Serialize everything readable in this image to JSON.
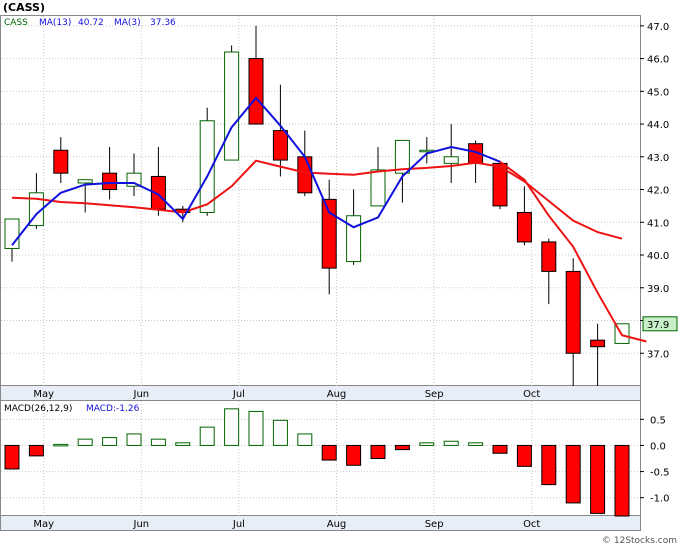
{
  "header": {
    "title": "(CASS)",
    "legend": {
      "ticker": "CASS",
      "ma13_label": "MA(13)",
      "ma13_value": "40.72",
      "ma3_label": "MA(3)",
      "ma3_value": "37.36"
    },
    "macd_legend": {
      "label": "MACD(26,12,9)",
      "value_label": "MACD:-1.26"
    }
  },
  "footer": {
    "copyright": "© 12Stocks.com"
  },
  "colors": {
    "down_candle": "#ff0000",
    "up_candle": "#ffffff",
    "up_outline": "#006400",
    "ma13": "#ee1111",
    "ma3": "#1111dd",
    "macd_neg": "#ff0000",
    "macd_pos": "#ffffff",
    "last_price_box": "#c8f0c8",
    "grid": "#c8c8c8",
    "text_dark": "#000000",
    "text_blue": "#1111dd",
    "text_green": "#006400"
  },
  "chart_data": [
    {
      "type": "candlestick",
      "title": "(CASS)",
      "x_tick_labels": [
        "May",
        "Jun",
        "Jul",
        "Aug",
        "Sep",
        "Oct"
      ],
      "x_tick_index": [
        1.3,
        5.3,
        9.3,
        13.3,
        17.3,
        21.3
      ],
      "y_ticks": [
        37.0,
        38.0,
        39.0,
        40.0,
        41.0,
        42.0,
        43.0,
        44.0,
        45.0,
        46.0,
        47.0
      ],
      "y_tick_labels": [
        "37.0",
        "38.0",
        "39.0",
        "40.0",
        "41.0",
        "42.0",
        "43.0",
        "44.0",
        "45.0",
        "46.0",
        "47.0"
      ],
      "ylim": [
        36.0,
        47.3
      ],
      "last_price": "37.9",
      "legend": [
        "CASS",
        "MA(13) 40.72",
        "MA(3) 37.36"
      ],
      "candles": [
        {
          "o": 40.2,
          "h": 41.0,
          "l": 39.8,
          "c": 41.1
        },
        {
          "o": 40.9,
          "h": 42.5,
          "l": 40.8,
          "c": 41.9
        },
        {
          "o": 43.2,
          "h": 43.6,
          "l": 42.2,
          "c": 42.5
        },
        {
          "o": 42.2,
          "h": 42.3,
          "l": 41.3,
          "c": 42.3
        },
        {
          "o": 42.5,
          "h": 43.3,
          "l": 41.7,
          "c": 42.0
        },
        {
          "o": 42.1,
          "h": 43.1,
          "l": 41.8,
          "c": 42.5
        },
        {
          "o": 42.4,
          "h": 43.3,
          "l": 41.2,
          "c": 41.4
        },
        {
          "o": 41.4,
          "h": 41.5,
          "l": 41.0,
          "c": 41.3
        },
        {
          "o": 41.3,
          "h": 44.5,
          "l": 41.2,
          "c": 44.1
        },
        {
          "o": 42.9,
          "h": 46.4,
          "l": 42.9,
          "c": 46.2
        },
        {
          "o": 46.0,
          "h": 47.0,
          "l": 44.0,
          "c": 44.0
        },
        {
          "o": 43.8,
          "h": 45.2,
          "l": 42.4,
          "c": 42.9
        },
        {
          "o": 43.0,
          "h": 43.8,
          "l": 41.8,
          "c": 41.9
        },
        {
          "o": 41.7,
          "h": 42.3,
          "l": 38.8,
          "c": 39.6
        },
        {
          "o": 39.8,
          "h": 42.0,
          "l": 39.7,
          "c": 41.2
        },
        {
          "o": 41.5,
          "h": 43.3,
          "l": 41.5,
          "c": 42.6
        },
        {
          "o": 42.5,
          "h": 43.5,
          "l": 41.6,
          "c": 43.5
        },
        {
          "o": 43.2,
          "h": 43.6,
          "l": 42.8,
          "c": 43.2
        },
        {
          "o": 42.8,
          "h": 44.0,
          "l": 42.2,
          "c": 43.0
        },
        {
          "o": 43.4,
          "h": 43.5,
          "l": 42.2,
          "c": 42.8
        },
        {
          "o": 42.8,
          "h": 42.8,
          "l": 41.4,
          "c": 41.5
        },
        {
          "o": 41.3,
          "h": 42.1,
          "l": 40.3,
          "c": 40.4
        },
        {
          "o": 40.4,
          "h": 40.5,
          "l": 38.5,
          "c": 39.5
        },
        {
          "o": 39.5,
          "h": 39.9,
          "l": 36.0,
          "c": 37.0
        },
        {
          "o": 37.4,
          "h": 37.9,
          "l": 36.0,
          "c": 37.2
        },
        {
          "o": 37.3,
          "h": 37.9,
          "l": 37.3,
          "c": 37.9
        }
      ],
      "series": [
        {
          "name": "MA(13)",
          "color": "#ee1111",
          "start_index": 0,
          "values": [
            41.75,
            41.72,
            41.62,
            41.58,
            41.52,
            41.46,
            41.38,
            41.3,
            41.55,
            42.1,
            42.88,
            42.7,
            42.52,
            42.48,
            42.45,
            42.55,
            42.62,
            42.66,
            42.72,
            42.82,
            42.7,
            42.25,
            41.65,
            41.05,
            40.7,
            40.5
          ]
        },
        {
          "name": "MA(3)",
          "color": "#1111dd",
          "start_index": 0,
          "values": [
            40.3,
            41.25,
            41.9,
            42.15,
            42.2,
            42.2,
            41.85,
            41.1,
            42.4,
            43.9,
            44.8,
            43.95,
            43.0,
            41.3,
            40.85,
            41.15,
            42.4,
            43.1,
            43.3,
            43.15,
            42.85
          ]
        },
        {
          "name": "MA(13)-tail",
          "color": "#ee1111",
          "start_index": 0,
          "values": []
        }
      ]
    },
    {
      "type": "bar",
      "title": "MACD(26,12,9)",
      "legend": [
        "MACD(26,12,9)",
        "MACD:-1.26"
      ],
      "values": [
        -0.45,
        -0.2,
        0.02,
        0.12,
        0.15,
        0.22,
        0.12,
        0.05,
        0.35,
        0.7,
        0.65,
        0.48,
        0.22,
        -0.28,
        -0.38,
        -0.25,
        -0.08,
        0.05,
        0.08,
        0.05,
        -0.15,
        -0.4,
        -0.75,
        -1.1,
        -1.3,
        -1.35
      ],
      "y_ticks": [
        0.5,
        0.0,
        -0.5,
        -1.0
      ],
      "y_tick_labels": [
        "0.5",
        "0.0",
        "-0.5",
        "-1.0"
      ],
      "ylim": [
        -1.35,
        0.85
      ],
      "x_tick_labels": [
        "May",
        "Jun",
        "Jul",
        "Aug",
        "Sep",
        "Oct"
      ],
      "x_tick_index": [
        1.3,
        5.3,
        9.3,
        13.3,
        17.3,
        21.3
      ]
    }
  ]
}
